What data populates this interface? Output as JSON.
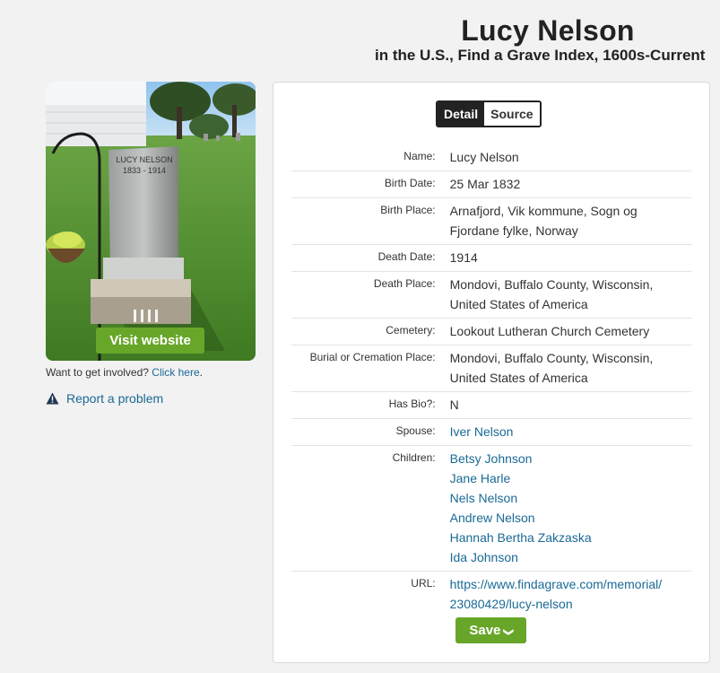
{
  "header": {
    "title": "Lucy Nelson",
    "subtitle": "in the U.S., Find a Grave Index, 1600s-Current"
  },
  "sidebar": {
    "visit_button": "Visit website",
    "involved_text": "Want to get involved? ",
    "involved_link": "Click here",
    "involved_suffix": ".",
    "report_link": "Report a problem",
    "photo_inscription_line1": "LUCY NELSON",
    "photo_inscription_line2": "1833 - 1914"
  },
  "tabs": {
    "detail": "Detail",
    "source": "Source"
  },
  "record": {
    "name_label": "Name:",
    "name": "Lucy Nelson",
    "birth_date_label": "Birth Date:",
    "birth_date": "25 Mar 1832",
    "birth_place_label": "Birth Place:",
    "birth_place_1": "Arnafjord, Vik kommune, Sogn og",
    "birth_place_2": "Fjordane fylke, Norway",
    "death_date_label": "Death Date:",
    "death_date": "1914",
    "death_place_label": "Death Place:",
    "death_place_1": "Mondovi, Buffalo County, Wisconsin,",
    "death_place_2": "United States of America",
    "cemetery_label": "Cemetery:",
    "cemetery": "Lookout Lutheran Church Cemetery",
    "burial_label": "Burial or Cremation Place:",
    "burial_1": "Mondovi, Buffalo County, Wisconsin,",
    "burial_2": "United States of America",
    "has_bio_label": "Has Bio?:",
    "has_bio": "N",
    "spouse_label": "Spouse:",
    "spouse": "Iver Nelson",
    "children_label": "Children:",
    "children": [
      "Betsy Johnson",
      "Jane Harle",
      "Nels Nelson",
      "Andrew Nelson",
      "Hannah Bertha Zakzaska",
      "Ida Johnson"
    ],
    "url_label": "URL:",
    "url_1": "https://www.findagrave.com/memorial/",
    "url_2": "23080429/lucy-nelson"
  },
  "actions": {
    "save": "Save"
  },
  "colors": {
    "accent_green": "#68a629",
    "link_blue": "#1a6a96"
  }
}
